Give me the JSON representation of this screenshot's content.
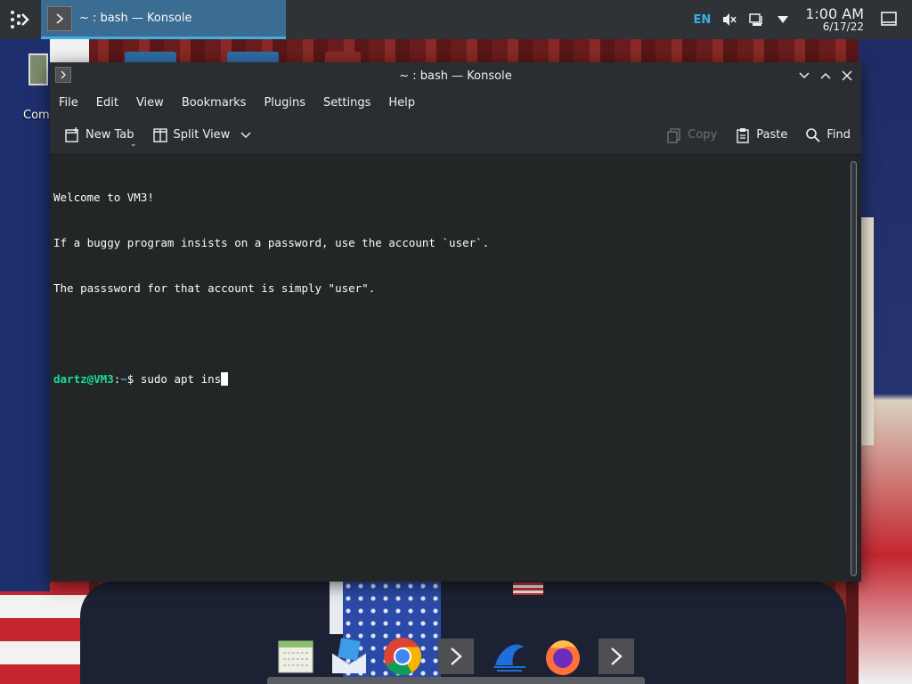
{
  "top_panel": {
    "launcher_icon": "kde-launcher-icon",
    "task": {
      "label": "~ : bash — Konsole",
      "icon": "terminal-icon"
    },
    "tray": {
      "language": "EN",
      "icons": [
        "volume-muted-icon",
        "network-icon",
        "expand-tray-icon"
      ],
      "clock_time": "1:00 AM",
      "clock_date": "6/17/22",
      "show_desktop_icon": "show-desktop-icon"
    }
  },
  "desktop": {
    "icon_label": "Comp"
  },
  "window": {
    "title": "~ : bash — Konsole",
    "controls": [
      "minimize-icon",
      "maximize-icon",
      "close-icon"
    ],
    "menu": [
      "File",
      "Edit",
      "View",
      "Bookmarks",
      "Plugins",
      "Settings",
      "Help"
    ],
    "toolbar": {
      "new_tab": "New Tab",
      "split_view": "Split View",
      "copy": "Copy",
      "paste": "Paste",
      "find": "Find"
    },
    "terminal": {
      "lines": [
        "Welcome to VM3!",
        "If a buggy program insists on a password, use the account `user`.",
        "The passsword for that account is simply \"user\".",
        ""
      ],
      "prompt_user": "dartz@VM3",
      "prompt_sep": ":",
      "prompt_path": "~",
      "prompt_symbol": "$ ",
      "command": "sudo apt ins"
    }
  },
  "dock": {
    "apps": [
      "calendar-icon",
      "mail-icon",
      "chrome-icon",
      "terminal-icon",
      "app-icon",
      "firefox-icon",
      "terminal-icon"
    ]
  },
  "colors": {
    "accent": "#3daee9",
    "prompt_user": "#1cdc9a",
    "terminal_bg": "#232627",
    "window_bg": "#2a2e32"
  }
}
